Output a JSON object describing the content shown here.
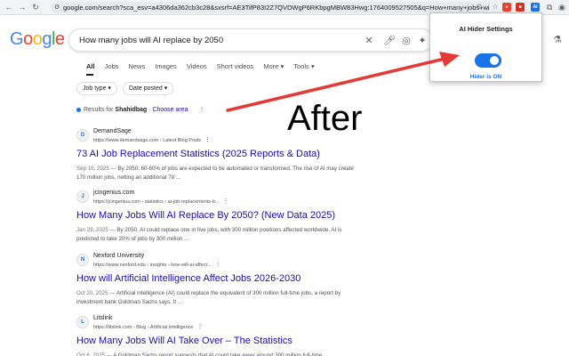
{
  "browser": {
    "url": "google.com/search?sca_esv=a4306da362cb3c28&sxsrf=AE3TifP83I2Z7QVDWgP6RKbpgMBW83Hwg:1764009527505&q=How+many+jobs+will+ai",
    "extensions": [
      {
        "name": "pin-icon",
        "color": "#5f6368"
      },
      {
        "name": "extension-1",
        "color": "#ea4335"
      },
      {
        "name": "extension-2",
        "color": "#34a853"
      },
      {
        "name": "extension-ai-hider",
        "color": "#1a73e8"
      }
    ]
  },
  "google": {
    "logo_letters": [
      {
        "ch": "G",
        "color": "#4285f4"
      },
      {
        "ch": "o",
        "color": "#ea4335"
      },
      {
        "ch": "o",
        "color": "#fbbc05"
      },
      {
        "ch": "g",
        "color": "#4285f4"
      },
      {
        "ch": "l",
        "color": "#34a853"
      },
      {
        "ch": "e",
        "color": "#ea4335"
      }
    ],
    "query": "How many jobs will AI replace by 2050",
    "tabs": [
      "All",
      "Jobs",
      "News",
      "Images",
      "Videos",
      "Short videos",
      "More ▾",
      "Tools ▾"
    ],
    "filters": [
      "Job type ▾",
      "Date posted ▾"
    ],
    "location": {
      "prefix": "Results for",
      "place": "Shahidbag",
      "link": "Choose area"
    }
  },
  "results": [
    {
      "site": "DemandSage",
      "crumb": "https://www.demandsage.com › Latest Blog Posts",
      "title": "73 AI Job Replacement Statistics (2025 Reports & Data)",
      "date": "Sep 10, 2025 —",
      "snippet": "By 2050, 60-80% of jobs are expected to be automated or transformed. The rise of AI may create 170 million jobs, netting an additional 78 ...",
      "fav": "D"
    },
    {
      "site": "jcingenius.com",
      "crumb": "https://jcingenius.com › statistics › ai-job-replacements-b...",
      "title": "How Many Jobs Will AI Replace By 2050? (New Data 2025)",
      "date": "Jan 29, 2025 —",
      "snippet": "By 2050, AI could replace one in five jobs, with 300 million positions affected worldwide. AI is predicted to take 20% of jobs by 300 million ...",
      "fav": "J"
    },
    {
      "site": "Nexford University",
      "crumb": "https://www.nexford.edu › insights › how-will-ai-affect...",
      "title": "How will Artificial Intelligence Affect Jobs 2026-2030",
      "date": "Oct 20, 2025 —",
      "snippet": "Artificial intelligence (AI) could replace the equivalent of 300 million full-time jobs, a report by investment bank Goldman Sachs says. It ...",
      "fav": "N"
    },
    {
      "site": "Litslink",
      "crumb": "https://litslink.com › Blog › Artificial Intelligence",
      "title": "How Many Jobs Will AI Take Over – The Statistics",
      "date": "Oct 6, 2025 —",
      "snippet": "A Goldman Sachs report suggests that AI could take away around 300 million full-time",
      "fav": "L"
    }
  ],
  "popup": {
    "title": "AI Hider Settings",
    "status": "Hider is ON",
    "enabled": true
  },
  "annotation": {
    "text": "After",
    "arrow_color": "#e53935"
  }
}
